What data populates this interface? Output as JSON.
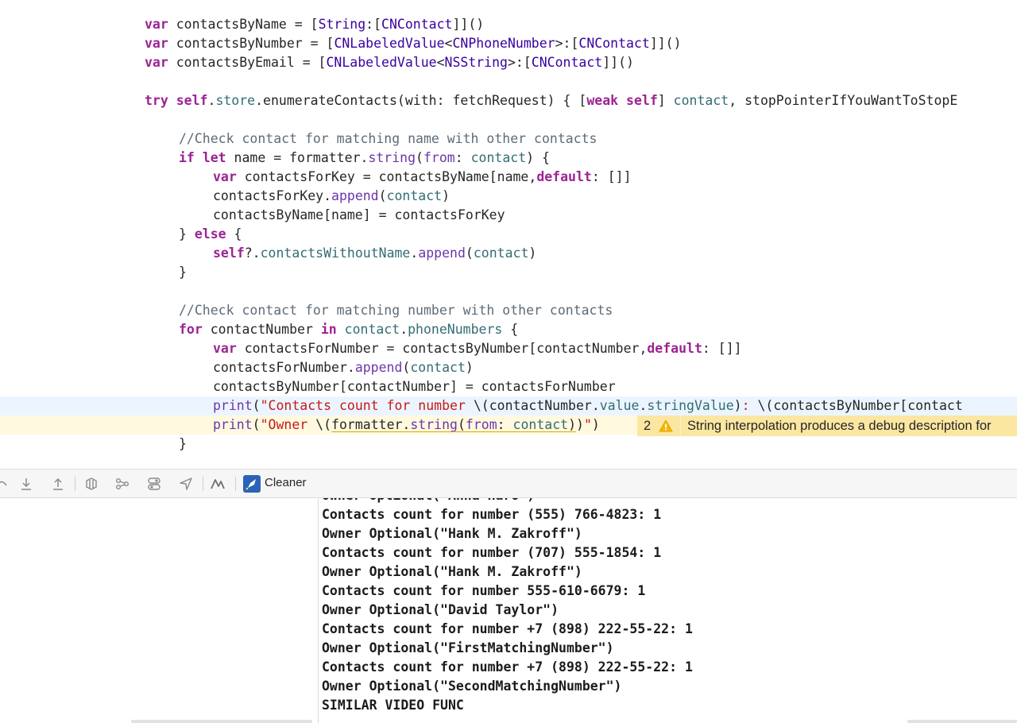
{
  "editor": {
    "lines": [
      {
        "indent": 0,
        "tokens": [
          [
            "kw",
            "var"
          ],
          [
            "",
            " contactsByName = ["
          ],
          [
            "ty",
            "String"
          ],
          [
            "",
            ":["
          ],
          [
            "ty",
            "CNContact"
          ],
          [
            "",
            "]]()"
          ]
        ]
      },
      {
        "indent": 0,
        "tokens": [
          [
            "kw",
            "var"
          ],
          [
            "",
            " contactsByNumber = ["
          ],
          [
            "ty",
            "CNLabeledValue"
          ],
          [
            "",
            "<"
          ],
          [
            "ty",
            "CNPhoneNumber"
          ],
          [
            "",
            ">:["
          ],
          [
            "ty",
            "CNContact"
          ],
          [
            "",
            "]]()"
          ]
        ]
      },
      {
        "indent": 0,
        "tokens": [
          [
            "kw",
            "var"
          ],
          [
            "",
            " contactsByEmail = ["
          ],
          [
            "ty",
            "CNLabeledValue"
          ],
          [
            "",
            "<"
          ],
          [
            "ty",
            "NSString"
          ],
          [
            "",
            ">:["
          ],
          [
            "ty",
            "CNContact"
          ],
          [
            "",
            "]]()"
          ]
        ]
      },
      {
        "indent": 0,
        "tokens": []
      },
      {
        "indent": 0,
        "tokens": [
          [
            "kw",
            "try"
          ],
          [
            "",
            " "
          ],
          [
            "kw",
            "self"
          ],
          [
            "",
            "."
          ],
          [
            "pr",
            "store"
          ],
          [
            "",
            ".enumerateContacts(with: fetchRequest) { ["
          ],
          [
            "kw",
            "weak"
          ],
          [
            "",
            " "
          ],
          [
            "kw",
            "self"
          ],
          [
            "",
            "] "
          ],
          [
            "pr",
            "contact"
          ],
          [
            "",
            ", stopPointerIfYouWantToStopE"
          ]
        ]
      },
      {
        "indent": 0,
        "tokens": []
      },
      {
        "indent": 1,
        "tokens": [
          [
            "cm",
            "//Check contact for matching name with other contacts"
          ]
        ]
      },
      {
        "indent": 1,
        "tokens": [
          [
            "kw",
            "if"
          ],
          [
            "",
            " "
          ],
          [
            "kw",
            "let"
          ],
          [
            "",
            " name = formatter."
          ],
          [
            "fn",
            "string"
          ],
          [
            "",
            "("
          ],
          [
            "fn",
            "from"
          ],
          [
            "",
            ": "
          ],
          [
            "pr",
            "contact"
          ],
          [
            "",
            ") {"
          ]
        ]
      },
      {
        "indent": 2,
        "tokens": [
          [
            "kw",
            "var"
          ],
          [
            "",
            " contactsForKey = contactsByName[name,"
          ],
          [
            "kw",
            "default"
          ],
          [
            "",
            ": []]"
          ]
        ]
      },
      {
        "indent": 2,
        "tokens": [
          [
            "",
            "contactsForKey."
          ],
          [
            "fn",
            "append"
          ],
          [
            "",
            "("
          ],
          [
            "pr",
            "contact"
          ],
          [
            "",
            ")"
          ]
        ]
      },
      {
        "indent": 2,
        "tokens": [
          [
            "",
            "contactsByName[name] = contactsForKey"
          ]
        ]
      },
      {
        "indent": 1,
        "tokens": [
          [
            "",
            "} "
          ],
          [
            "kw",
            "else"
          ],
          [
            "",
            " {"
          ]
        ]
      },
      {
        "indent": 2,
        "tokens": [
          [
            "kw",
            "self"
          ],
          [
            "",
            "?."
          ],
          [
            "pr",
            "contactsWithoutName"
          ],
          [
            "",
            "."
          ],
          [
            "fn",
            "append"
          ],
          [
            "",
            "("
          ],
          [
            "pr",
            "contact"
          ],
          [
            "",
            ")"
          ]
        ]
      },
      {
        "indent": 1,
        "tokens": [
          [
            "",
            "}"
          ]
        ]
      },
      {
        "indent": 0,
        "tokens": []
      },
      {
        "indent": 1,
        "tokens": [
          [
            "cm",
            "//Check contact for matching number with other contacts"
          ]
        ]
      },
      {
        "indent": 1,
        "tokens": [
          [
            "kw",
            "for"
          ],
          [
            "",
            " contactNumber "
          ],
          [
            "kw",
            "in"
          ],
          [
            "",
            " "
          ],
          [
            "pr",
            "contact"
          ],
          [
            "",
            "."
          ],
          [
            "pr",
            "phoneNumbers"
          ],
          [
            "",
            " {"
          ]
        ]
      },
      {
        "indent": 2,
        "tokens": [
          [
            "kw",
            "var"
          ],
          [
            "",
            " contactsForNumber = contactsByNumber[contactNumber,"
          ],
          [
            "kw",
            "default"
          ],
          [
            "",
            ": []]"
          ]
        ]
      },
      {
        "indent": 2,
        "tokens": [
          [
            "",
            "contactsForNumber."
          ],
          [
            "fn",
            "append"
          ],
          [
            "",
            "("
          ],
          [
            "pr",
            "contact"
          ],
          [
            "",
            ")"
          ]
        ]
      },
      {
        "indent": 2,
        "tokens": [
          [
            "",
            "contactsByNumber[contactNumber] = contactsForNumber"
          ]
        ]
      },
      {
        "indent": 2,
        "highlight": "current",
        "tokens": [
          [
            "fn",
            "print"
          ],
          [
            "",
            "("
          ],
          [
            "st",
            "\"Contacts count for number "
          ],
          [
            "",
            "\\(contactNumber."
          ],
          [
            "pr",
            "value"
          ],
          [
            "",
            "."
          ],
          [
            "pr",
            "stringValue"
          ],
          [
            "",
            ")"
          ],
          [
            "st",
            ": "
          ],
          [
            "",
            "\\(contactsByNumber[contact"
          ]
        ]
      },
      {
        "indent": 2,
        "highlight": "warn",
        "tokens": [
          [
            "fn",
            "print"
          ],
          [
            "",
            "("
          ],
          [
            "st",
            "\"Owner "
          ],
          [
            "",
            "\\("
          ],
          [
            "w",
            "formatter."
          ],
          [
            "wf",
            "string"
          ],
          [
            "w",
            "("
          ],
          [
            "wf",
            "from"
          ],
          [
            "w",
            ": "
          ],
          [
            "wp",
            "contact"
          ],
          [
            "w",
            ")"
          ],
          [
            "",
            ")"
          ],
          [
            "st",
            "\""
          ],
          [
            "",
            ")"
          ]
        ]
      },
      {
        "indent": 1,
        "tokens": [
          [
            "",
            "}"
          ]
        ]
      }
    ],
    "warning": {
      "count": "2",
      "icon": "warning-triangle-icon",
      "message": "String interpolation produces a debug description for"
    }
  },
  "debug_toolbar": {
    "icons": [
      "step-over-icon",
      "step-into-icon",
      "step-out-icon",
      "debug-view-hierarchy-icon",
      "memory-graph-icon",
      "environment-overrides-icon",
      "simulate-location-icon",
      "instruments-icon"
    ],
    "cleaner_label": "Cleaner"
  },
  "console": {
    "lines": [
      "Owner Optional(\"Anna Haro\")",
      "Contacts count for number (555) 766-4823: 1",
      "Owner Optional(\"Hank M. Zakroff\")",
      "Contacts count for number (707) 555-1854: 1",
      "Owner Optional(\"Hank M. Zakroff\")",
      "Contacts count for number 555-610-6679: 1",
      "Owner Optional(\"David Taylor\")",
      "Contacts count for number +7 (898) 222-55-22: 1",
      "Owner Optional(\"FirstMatchingNumber\")",
      "Contacts count for number +7 (898) 222-55-22: 1",
      "Owner Optional(\"SecondMatchingNumber\")",
      "SIMILAR VIDEO FUNC"
    ]
  }
}
